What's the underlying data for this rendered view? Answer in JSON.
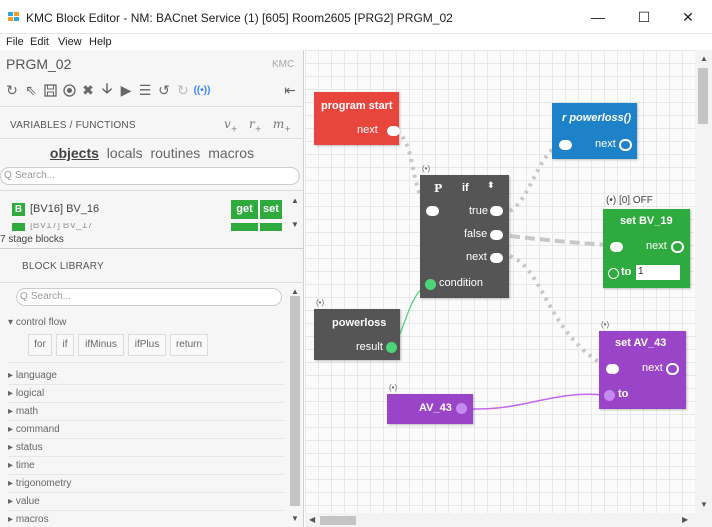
{
  "window": {
    "title": "KMC Block Editor - NM: BACnet Service (1) [605] Room2605 [PRG2] PRGM_02",
    "minimize": "—",
    "maximize": "☐",
    "close": "✕"
  },
  "menu": [
    "File",
    "Edit",
    "View",
    "Help"
  ],
  "program": {
    "name": "PRGM_02",
    "brand": "KMC"
  },
  "toolbar_icons": [
    "refresh-icon",
    "cursor-icon",
    "save-icon",
    "record-icon",
    "delete-icon",
    "download-icon",
    "play-icon",
    "list-icon",
    "undo-icon",
    "redo-icon",
    "broadcast-icon",
    "collapse-icon"
  ],
  "variables": {
    "header": "VARIABLES / FUNCTIONS",
    "icons": {
      "v": "v",
      "r": "r",
      "m": "m",
      "plus": "+"
    },
    "tabs": [
      "objects",
      "locals",
      "routines",
      "macros"
    ],
    "search_placeholder": "Search...",
    "rows": [
      {
        "badge": "B",
        "name": "[BV16] BV_16",
        "get": "get",
        "set": "set"
      }
    ],
    "stage_blocks": "7 stage blocks"
  },
  "library": {
    "header": "BLOCK LIBRARY",
    "search_placeholder": "Search...",
    "control_flow": {
      "label": "control flow",
      "buttons": [
        "for",
        "if",
        "ifMinus",
        "ifPlus",
        "return"
      ]
    },
    "categories": [
      "language",
      "logical",
      "math",
      "command",
      "status",
      "time",
      "trigonometry",
      "value",
      "macros"
    ]
  },
  "blocks": {
    "program_start": {
      "title": "program start",
      "next": "next"
    },
    "powerloss_fn": {
      "title": "r powerloss()",
      "next": "next"
    },
    "if_block": {
      "icon": "P",
      "title": "if",
      "true": "true",
      "false": "false",
      "next": "next",
      "condition": "condition",
      "ann": "(•)"
    },
    "set_bv": {
      "title": "set BV_19",
      "next": "next",
      "to": "to",
      "value": "1",
      "ann": "(•) [0] OFF"
    },
    "powerloss": {
      "title": "powerloss",
      "result": "result",
      "ann": "(•)"
    },
    "set_av": {
      "title": "set AV_43",
      "next": "next",
      "to": "to",
      "ann": "(•)"
    },
    "av_value": {
      "title": "AV_43",
      "ann": "(•)"
    }
  },
  "colors": {
    "red": "#e8453c",
    "blue": "#1e82c9",
    "dark": "#555555",
    "green": "#2eaa3e",
    "purple": "#9a45c7",
    "condition_wire": "#4cd479",
    "value_wire": "#c466ee"
  }
}
